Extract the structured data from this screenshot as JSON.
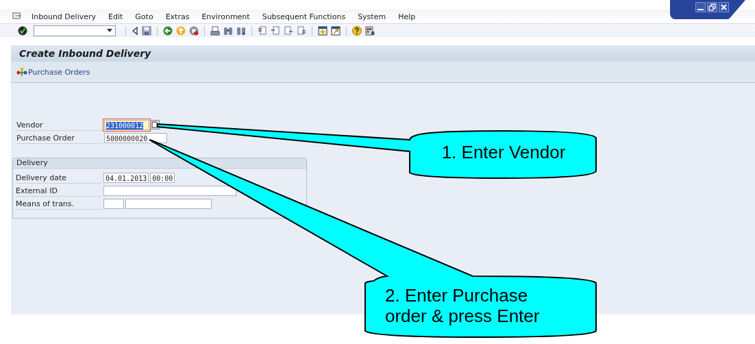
{
  "menu": [
    {
      "label": "Inbound Delivery"
    },
    {
      "label": "Edit"
    },
    {
      "label": "Goto"
    },
    {
      "label": "Extras"
    },
    {
      "label": "Environment"
    },
    {
      "label": "Subsequent Functions"
    },
    {
      "label": "System"
    },
    {
      "label": "Help"
    }
  ],
  "screen": {
    "title": "Create Inbound Delivery",
    "app_toolbar": [
      {
        "label": "Purchase Orders"
      }
    ]
  },
  "fields": [
    {
      "label": "Vendor",
      "value": "231000012",
      "focused": true,
      "value_help": true
    },
    {
      "label": "Purchase Order",
      "value": "5000000020",
      "focused": false,
      "value_help": false
    }
  ],
  "delivery_group": {
    "title": "Delivery",
    "rows": [
      {
        "label": "Delivery date",
        "inputs": [
          {
            "kind": "medium",
            "value": "04.01.2013"
          },
          {
            "kind": "short",
            "value": "00:00"
          }
        ]
      },
      {
        "label": "External ID",
        "inputs": [
          {
            "kind": "long"
          }
        ]
      },
      {
        "label": "Means of trans.",
        "inputs": [
          {
            "kind": "short"
          },
          {
            "kind": "wide"
          }
        ]
      }
    ]
  },
  "callouts": [
    {
      "text": "1. Enter Vendor"
    },
    {
      "text": "2. Enter Purchase order & press Enter"
    }
  ]
}
